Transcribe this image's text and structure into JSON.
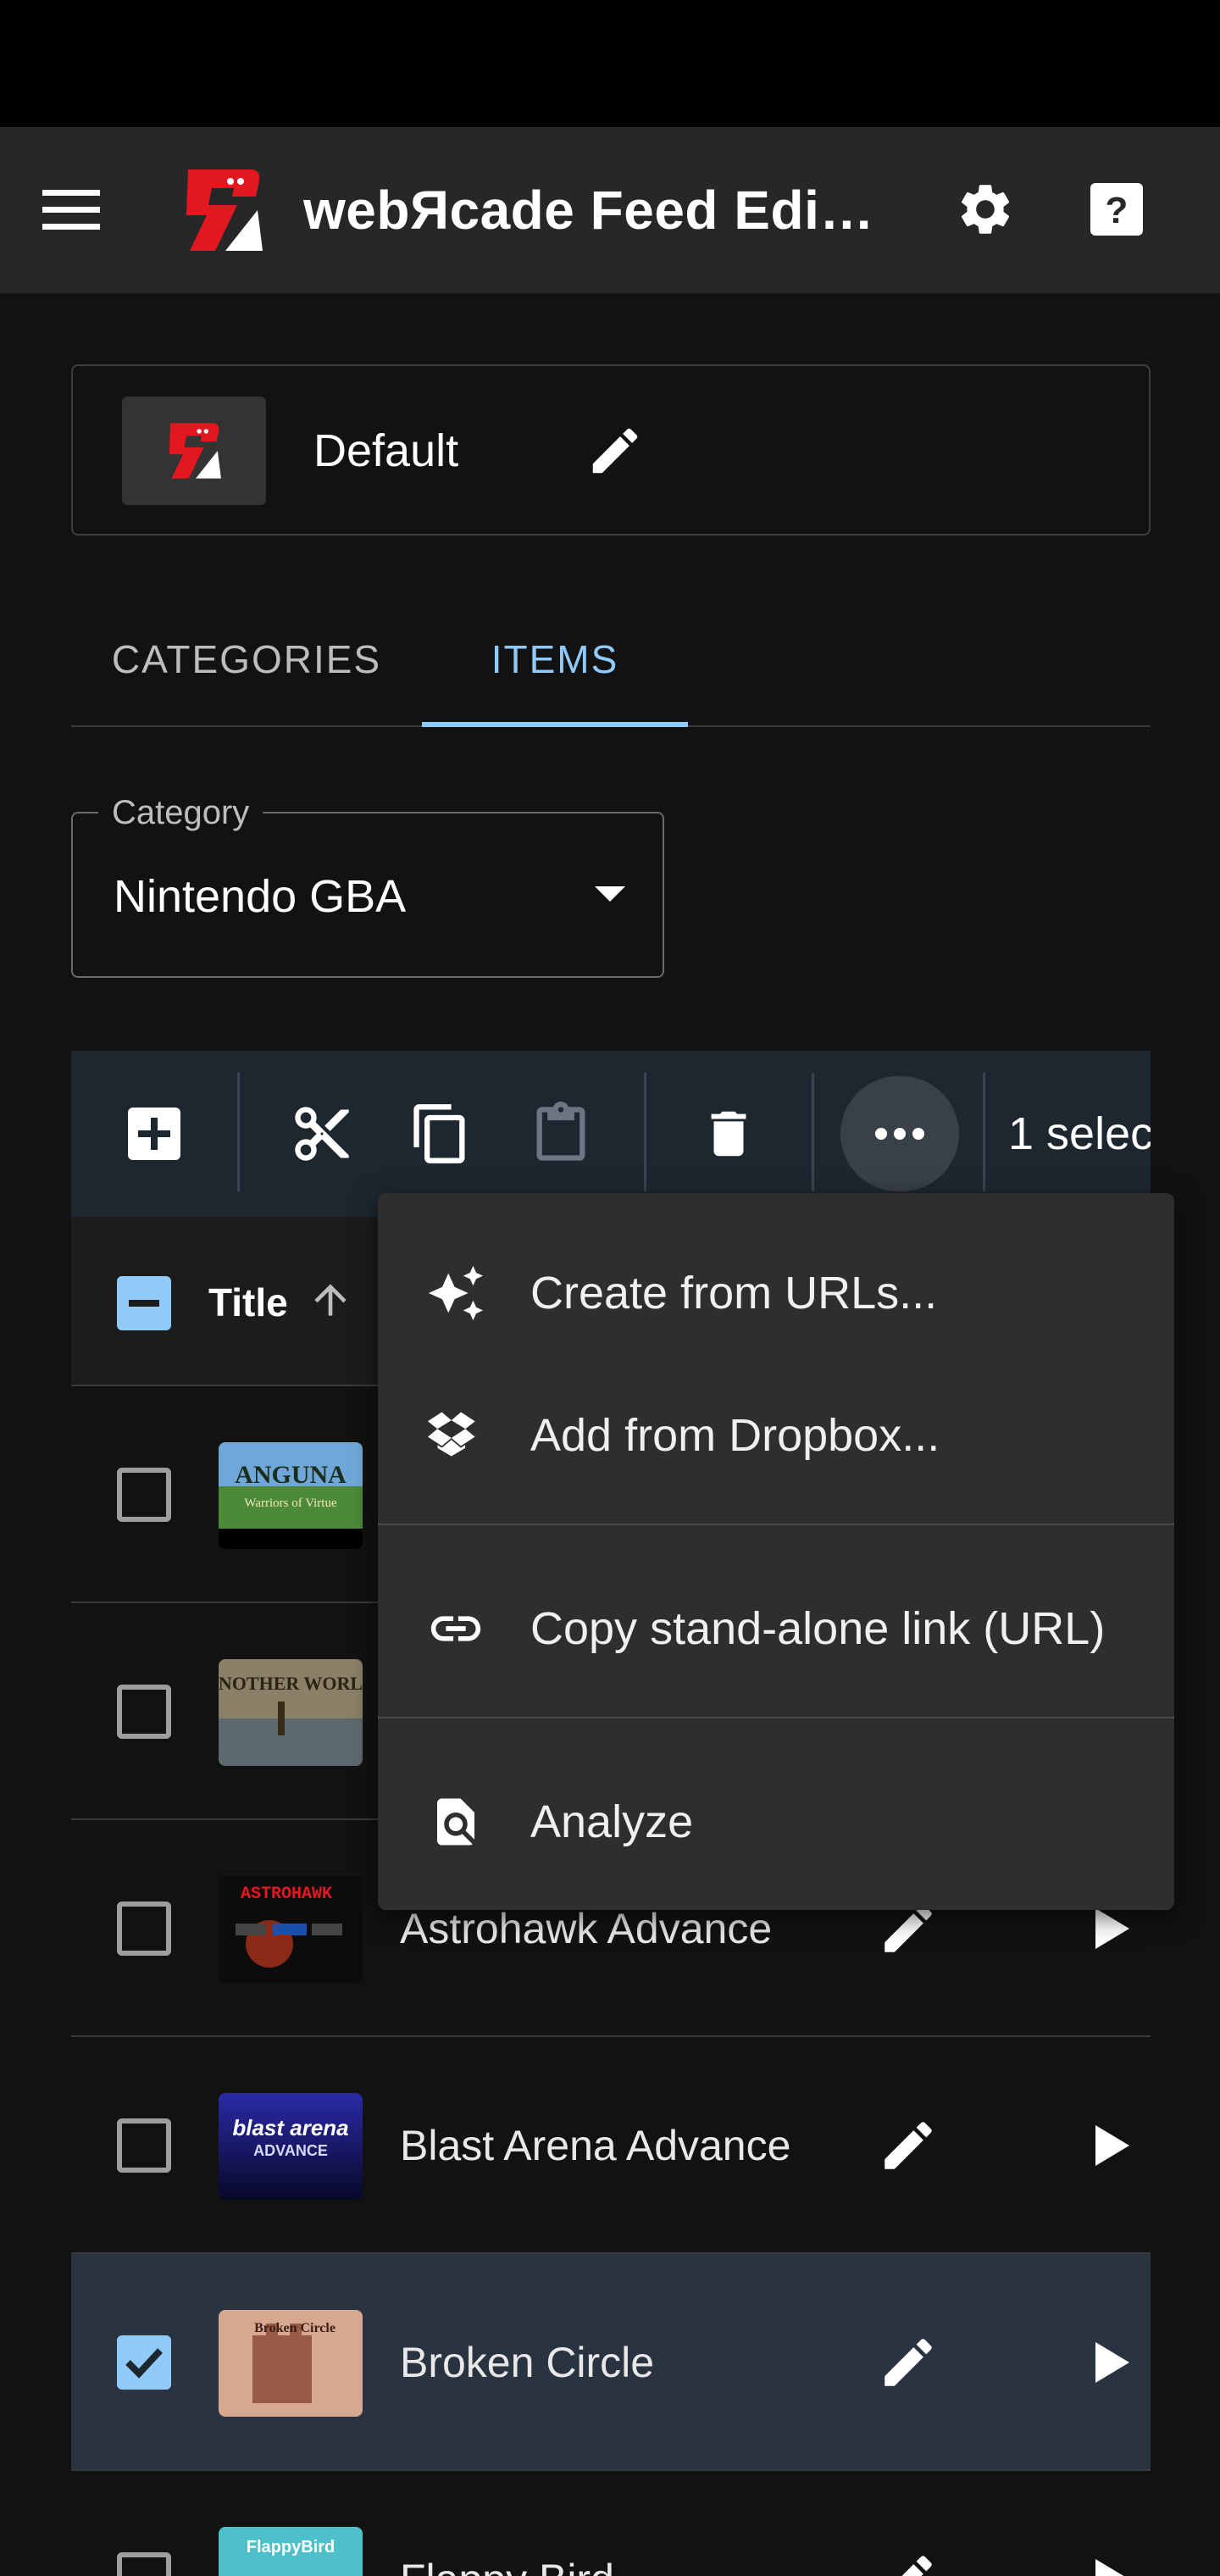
{
  "app_bar": {
    "title": "webЯcade Feed Edi…",
    "icons": [
      "menu-icon",
      "webrcade-logo",
      "gear-icon",
      "help-icon"
    ]
  },
  "feed": {
    "name": "Default"
  },
  "tabs": [
    {
      "label": "CATEGORIES",
      "active": false
    },
    {
      "label": "ITEMS",
      "active": true
    }
  ],
  "category": {
    "legend": "Category",
    "value": "Nintendo GBA"
  },
  "toolbar": {
    "icons": [
      "add-icon",
      "cut-icon",
      "copy-icon",
      "paste-icon",
      "delete-icon",
      "more-icon"
    ],
    "selected_text": "1 selec"
  },
  "table": {
    "column_title": "Title",
    "rows": [
      {
        "name": "",
        "checked": false
      },
      {
        "name": "",
        "checked": false
      },
      {
        "name": "Astrohawk Advance",
        "checked": false
      },
      {
        "name": "Blast Arena Advance",
        "checked": false
      },
      {
        "name": "Broken Circle",
        "checked": true
      },
      {
        "name": "Flappy Bird",
        "checked": false
      }
    ],
    "thumb_texts": {
      "anguna_title": "ANGUNA",
      "anguna_sub": "Warriors of Virtue",
      "another_world": "ANOTHER WORLD",
      "astrohawk": "ASTROHAWK",
      "blast_arena": "blast arena",
      "blast_advance": "ADVANCE",
      "broken_circle": "Broken Circle",
      "flappy": "FlappyBird"
    }
  },
  "menu": {
    "items": [
      {
        "label": "Create from URLs...",
        "icon": "sparkle-icon"
      },
      {
        "label": "Add from Dropbox...",
        "icon": "dropbox-icon"
      },
      {
        "label": "Copy stand-alone link (URL)",
        "icon": "link-icon"
      },
      {
        "label": "Analyze",
        "icon": "analyze-icon"
      }
    ]
  },
  "colors": {
    "accent": "#90caf9",
    "app_bar": "#272727",
    "background": "#121212",
    "logo_red": "#e3171f"
  }
}
